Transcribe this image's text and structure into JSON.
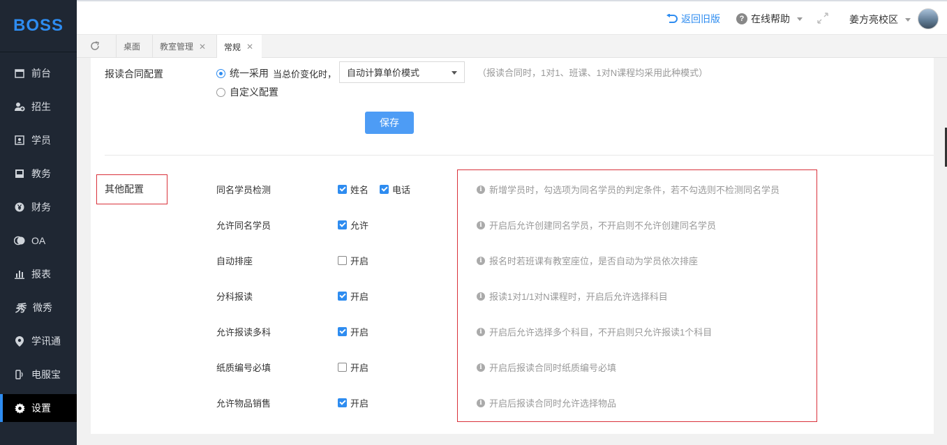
{
  "logo": "BOSS",
  "sidebar": {
    "items": [
      {
        "label": "前台",
        "icon": "calendar-icon"
      },
      {
        "label": "招生",
        "icon": "user-add-icon"
      },
      {
        "label": "学员",
        "icon": "id-card-icon"
      },
      {
        "label": "教务",
        "icon": "book-icon"
      },
      {
        "label": "财务",
        "icon": "yen-icon"
      },
      {
        "label": "OA",
        "icon": "toggle-icon"
      },
      {
        "label": "报表",
        "icon": "bar-chart-icon"
      },
      {
        "label": "微秀",
        "icon": "xiu-icon"
      },
      {
        "label": "学讯通",
        "icon": "location-pin-icon"
      },
      {
        "label": "电服宝",
        "icon": "phone-icon"
      },
      {
        "label": "设置",
        "icon": "gear-icon",
        "active": true
      }
    ]
  },
  "header": {
    "back_label": "返回旧版",
    "help_label": "在线帮助",
    "campus_label": "姜方亮校区"
  },
  "tabs": [
    {
      "label": "桌面",
      "closable": false
    },
    {
      "label": "教室管理",
      "closable": true
    },
    {
      "label": "常规",
      "closable": true,
      "active": true
    }
  ],
  "contract": {
    "label": "报读合同配置",
    "option_unified": "统一采用",
    "price_change_label": "当总价变化时，",
    "select_value": "自动计算单价模式",
    "hint": "（报读合同时，1对1、班课、1对N课程均采用此种模式）",
    "option_custom": "自定义配置",
    "save_label": "保存"
  },
  "other": {
    "label": "其他配置",
    "settings": [
      {
        "name": "同名学员检测",
        "options": [
          {
            "label": "姓名",
            "checked": true
          },
          {
            "label": "电话",
            "checked": true
          }
        ],
        "desc": "新增学员时，勾选项为同名学员的判定条件，若不勾选则不检测同名学员"
      },
      {
        "name": "允许同名学员",
        "options": [
          {
            "label": "允许",
            "checked": true
          }
        ],
        "desc": "开启后允许创建同名学员，不开启则不允许创建同名学员"
      },
      {
        "name": "自动排座",
        "options": [
          {
            "label": "开启",
            "checked": false
          }
        ],
        "desc": "报名时若班课有教室座位，是否自动为学员依次排座"
      },
      {
        "name": "分科报读",
        "options": [
          {
            "label": "开启",
            "checked": true
          }
        ],
        "desc": "报读1对1/1对N课程时，开启后允许选择科目"
      },
      {
        "name": "允许报读多科",
        "options": [
          {
            "label": "开启",
            "checked": true
          }
        ],
        "desc": "开启后允许选择多个科目，不开启则只允许报读1个科目"
      },
      {
        "name": "纸质编号必填",
        "options": [
          {
            "label": "开启",
            "checked": false
          }
        ],
        "desc": "开启后报读合同时纸质编号必填"
      },
      {
        "name": "允许物品销售",
        "options": [
          {
            "label": "开启",
            "checked": true
          }
        ],
        "desc": "开启后报读合同时允许选择物品"
      }
    ]
  }
}
